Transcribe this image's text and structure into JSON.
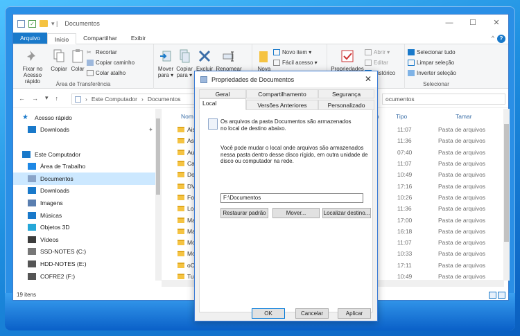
{
  "window": {
    "title": "Documentos",
    "tabs": [
      "Arquivo",
      "Início",
      "Compartilhar",
      "Exibir"
    ],
    "controls": {
      "minimize": "—",
      "maximize": "☐",
      "close": "✕"
    }
  },
  "ribbon": {
    "clipboard": {
      "label": "Área de Transferência",
      "pin": "Fixar no\nAcesso rápido",
      "copy": "Copiar",
      "paste": "Colar",
      "cut": "Recortar",
      "copy_path": "Copiar caminho",
      "paste_shortcut": "Colar atalho"
    },
    "organize": {
      "move": "Mover\npara ▾",
      "copy": "Copiar\npara ▾",
      "delete": "Excluir",
      "rename": "Renomear",
      "label_fragment": "O"
    },
    "new": {
      "folder": "Nova",
      "item": "Novo item ▾",
      "easy": "Fácil acesso ▾"
    },
    "open": {
      "props": "Propriedades",
      "open": "Abrir ▾",
      "edit": "Editar",
      "history": "Histórico"
    },
    "select": {
      "label": "Selecionar",
      "all": "Selecionar tudo",
      "none": "Limpar seleção",
      "invert": "Inverter seleção"
    }
  },
  "address": {
    "root": "Este Computador",
    "folder": "Documentos",
    "search": "ocumentos"
  },
  "nav_pane": [
    {
      "label": "Acesso rápido",
      "icon": "star-icon",
      "color": "#1979ca"
    },
    {
      "label": "Downloads",
      "icon": "download-arrow-icon",
      "color": "#1979ca"
    },
    {
      "label": "",
      "icon": "",
      "color": ""
    },
    {
      "label": "Este Computador",
      "icon": "computer-icon",
      "color": "#1979ca"
    },
    {
      "label": "Área de Trabalho",
      "icon": "desktop-icon",
      "color": "#1e88e5"
    },
    {
      "label": "Documentos",
      "icon": "document-icon",
      "color": "#8aa4c8"
    },
    {
      "label": "Downloads",
      "icon": "download-arrow-icon",
      "color": "#1979ca"
    },
    {
      "label": "Imagens",
      "icon": "image-icon",
      "color": "#5a7fb0"
    },
    {
      "label": "Músicas",
      "icon": "music-icon",
      "color": "#1979ca"
    },
    {
      "label": "Objetos 3D",
      "icon": "cube-icon",
      "color": "#25a7d8"
    },
    {
      "label": "Vídeos",
      "icon": "film-icon",
      "color": "#3c3c3c"
    },
    {
      "label": "SSD-NOTES (C:)",
      "icon": "drive-icon",
      "color": "#777"
    },
    {
      "label": "HDD-NOTES (E:)",
      "icon": "drive-icon",
      "color": "#555"
    },
    {
      "label": "COFRE2 (F:)",
      "icon": "drive-icon",
      "color": "#555"
    }
  ],
  "file_list": {
    "headers": {
      "name": "Nom",
      "modified": "dificação",
      "type": "Tipo",
      "size": "Tamar"
    },
    "rows": [
      {
        "name": "Ais",
        "time": "11:07",
        "type": "Pasta de arquivos"
      },
      {
        "name": "Ask",
        "time": "11:36",
        "type": "Pasta de arquivos"
      },
      {
        "name": "Au",
        "time": "07:40",
        "type": "Pasta de arquivos"
      },
      {
        "name": "Ca",
        "time": "11:07",
        "type": "Pasta de arquivos"
      },
      {
        "name": "Do",
        "time": "10:49",
        "type": "Pasta de arquivos"
      },
      {
        "name": "DV",
        "time": "17:16",
        "type": "Pasta de arquivos"
      },
      {
        "name": "For",
        "time": "10:26",
        "type": "Pasta de arquivos"
      },
      {
        "name": "Log",
        "time": "11:36",
        "type": "Pasta de arquivos"
      },
      {
        "name": "Ma",
        "time": "17:00",
        "type": "Pasta de arquivos"
      },
      {
        "name": "Ma",
        "time": "16:18",
        "type": "Pasta de arquivos"
      },
      {
        "name": "Mo",
        "time": "11:07",
        "type": "Pasta de arquivos"
      },
      {
        "name": "Mo",
        "time": "10:33",
        "type": "Pasta de arquivos"
      },
      {
        "name": "oC",
        "time": "17:11",
        "type": "Pasta de arquivos"
      },
      {
        "name": "Tur",
        "time": "10:49",
        "type": "Pasta de arquivos"
      }
    ]
  },
  "status": {
    "count": "19 itens"
  },
  "dialog": {
    "title": "Propriedades de Documentos",
    "tabs_row1": [
      "Geral",
      "Compartilhamento",
      "Segurança"
    ],
    "tabs_row2": [
      "Local",
      "Versões Anteriores",
      "Personalizado"
    ],
    "intro": "Os arquivos da pasta Documentos são armazenados\nno local de destino abaixo.",
    "desc": "Você pode mudar o local onde arquivos são armazenados\nnessa pasta dentro desse disco rígido, em outra unidade de\ndisco ou computador na rede.",
    "path": "F:\\Documentos",
    "btn_restore": "Restaurar padrão",
    "btn_move": "Mover...",
    "btn_find": "Localizar destino...",
    "btn_ok": "OK",
    "btn_cancel": "Cancelar",
    "btn_apply": "Aplicar"
  }
}
